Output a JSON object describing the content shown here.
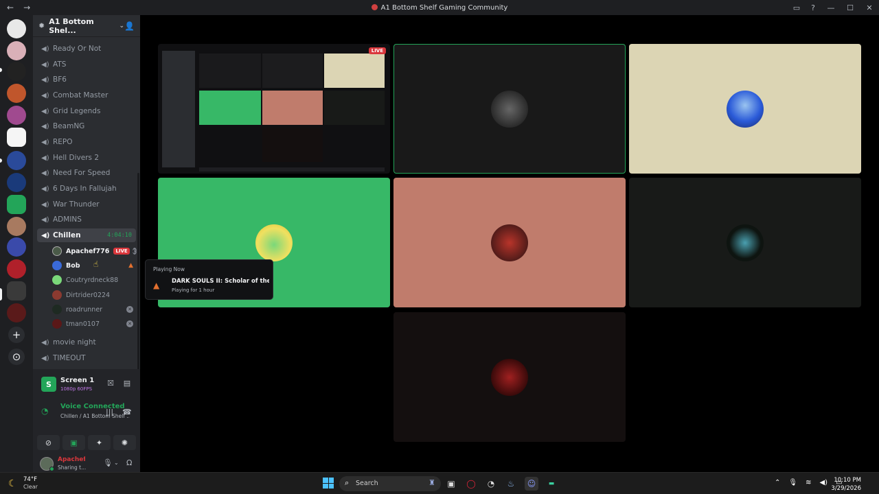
{
  "titlebar": {
    "title": "A1 Bottom Shelf Gaming Community",
    "back": "←",
    "forward": "→"
  },
  "rail": {
    "add": "+",
    "discover": "⊙"
  },
  "server_header": {
    "name": "A1 Bottom Shel..."
  },
  "channels": [
    {
      "name": "Ready Or Not"
    },
    {
      "name": "ATS"
    },
    {
      "name": "BF6"
    },
    {
      "name": "Combat Master"
    },
    {
      "name": "Grid Legends"
    },
    {
      "name": "BeamNG"
    },
    {
      "name": "REPO"
    },
    {
      "name": "Hell Divers 2"
    },
    {
      "name": "Need For Speed"
    },
    {
      "name": "6 Days In Fallujah"
    },
    {
      "name": "War Thunder"
    },
    {
      "name": "ADMINS"
    }
  ],
  "active_channel": {
    "name": "Chillen",
    "timer": "4:04:10"
  },
  "members": [
    {
      "name": "Apachef776",
      "live": "LIVE"
    },
    {
      "name": "Bob"
    },
    {
      "name": "Coutryrdneck88"
    },
    {
      "name": "Dirtrider0224"
    },
    {
      "name": "roadrunner"
    },
    {
      "name": "tman0107"
    }
  ],
  "channels_after": [
    {
      "name": "movie night"
    },
    {
      "name": "TIMEOUT"
    }
  ],
  "screen_share": {
    "title": "Screen 1",
    "quality": "1080p 60FPS"
  },
  "voice": {
    "status": "Voice Connected",
    "location": "Chillen / A1 Bottom Shelf ..."
  },
  "user": {
    "name": "Apachef...",
    "status": "Sharing t..."
  },
  "stage": {
    "live_tag": "LIVE"
  },
  "popover": {
    "label": "Playing Now",
    "game": "DARK SOULS II: Scholar of the F...",
    "duration": "Playing for 1 hour"
  },
  "taskbar": {
    "temperature": "74°F",
    "condition": "Clear",
    "search_placeholder": "Search",
    "time": "10:10 PM",
    "date": "3/29/2026"
  },
  "colors": {
    "accent_green": "#23a559",
    "live_red": "#da373c",
    "tile_cream": "#dcd5b4",
    "tile_green": "#37b867",
    "tile_salmon": "#c07c6c"
  }
}
